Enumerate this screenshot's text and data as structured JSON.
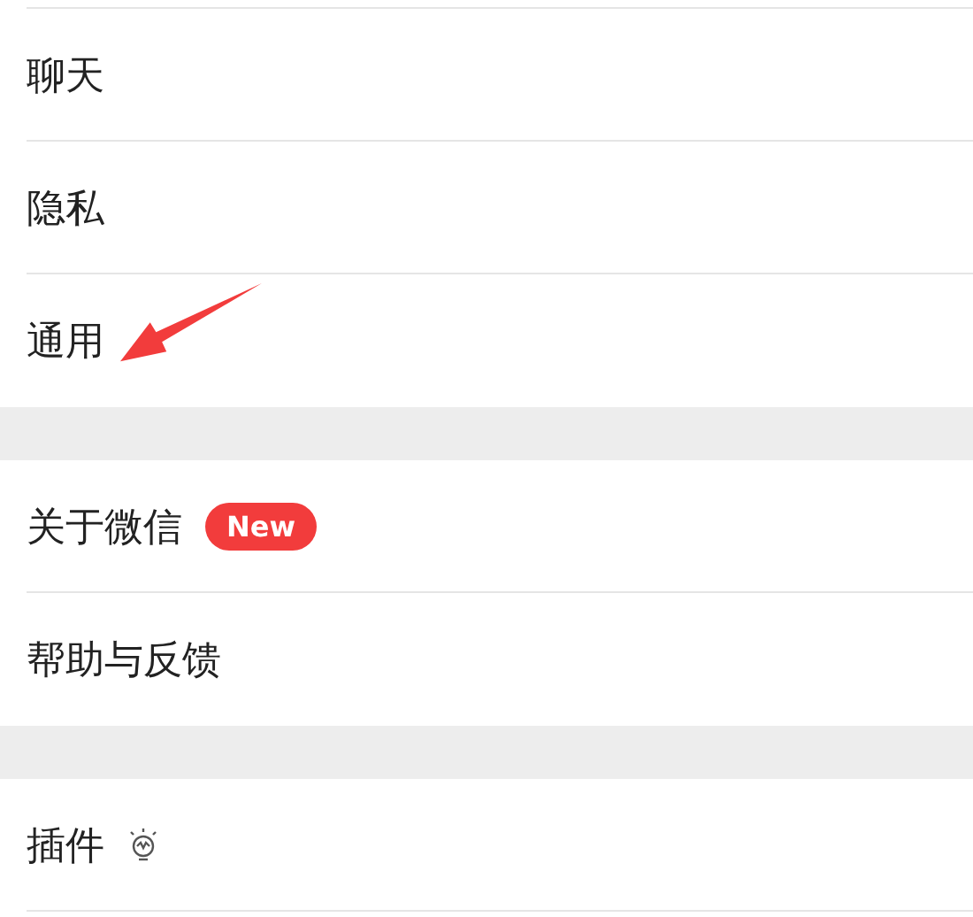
{
  "groups": [
    {
      "items": [
        {
          "label": "聊天",
          "kind": "plain",
          "pointed": false
        },
        {
          "label": "隐私",
          "kind": "plain",
          "pointed": false
        },
        {
          "label": "通用",
          "kind": "plain",
          "pointed": true
        }
      ]
    },
    {
      "items": [
        {
          "label": "关于微信",
          "kind": "badge",
          "badge": "New",
          "pointed": false
        },
        {
          "label": "帮助与反馈",
          "kind": "plain",
          "pointed": false
        }
      ]
    },
    {
      "items": [
        {
          "label": "插件",
          "kind": "icon",
          "pointed": false
        }
      ]
    }
  ]
}
